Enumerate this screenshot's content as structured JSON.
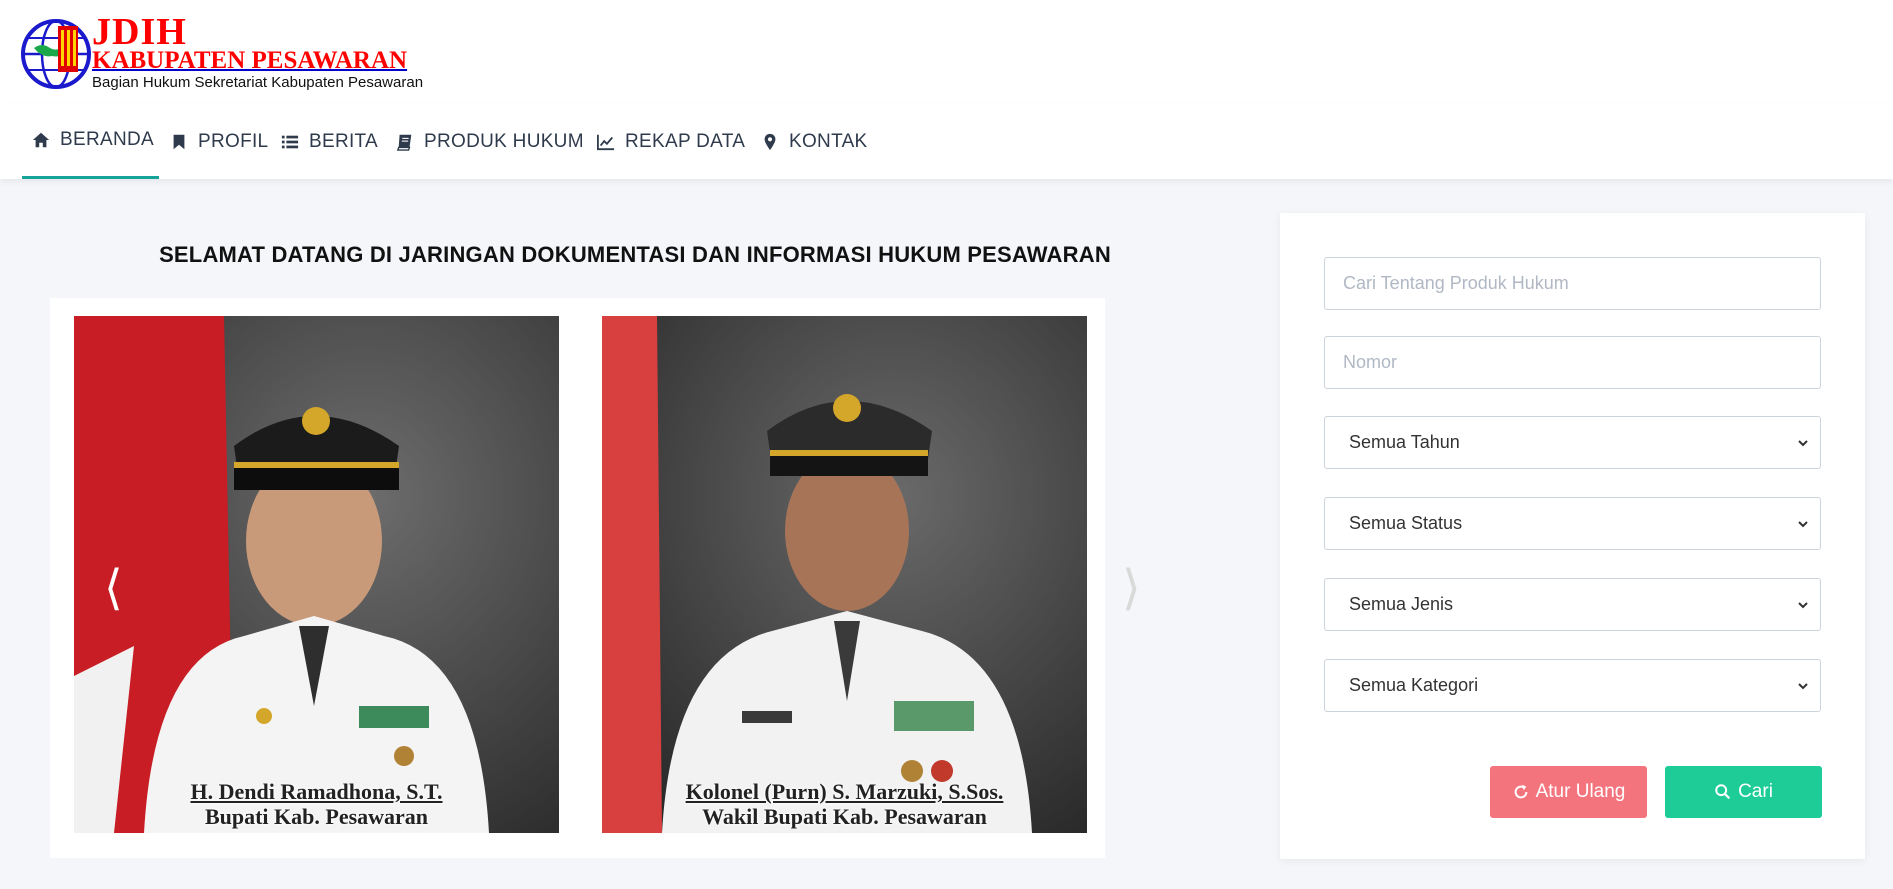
{
  "logo": {
    "title": "JDIH",
    "subtitle": "KABUPATEN PESAWARAN",
    "tagline": "Bagian Hukum Sekretariat Kabupaten Pesawaran"
  },
  "nav": {
    "items": [
      {
        "label": "BERANDA",
        "icon": "home-icon"
      },
      {
        "label": "PROFIL",
        "icon": "bookmark-icon"
      },
      {
        "label": "BERITA",
        "icon": "list-icon"
      },
      {
        "label": "PRODUK HUKUM",
        "icon": "book-icon"
      },
      {
        "label": "REKAP DATA",
        "icon": "line-chart-icon"
      },
      {
        "label": "KONTAK",
        "icon": "map-marker-icon"
      }
    ],
    "active": "BERANDA"
  },
  "main": {
    "welcome": "SELAMAT DATANG DI JARINGAN DOKUMENTASI DAN INFORMASI HUKUM PESAWARAN",
    "slides": [
      {
        "name": "H. Dendi Ramadhona, S.T.",
        "role": "Bupati Kab. Pesawaran"
      },
      {
        "name": "Kolonel (Purn) S. Marzuki, S.Sos.",
        "role": "Wakil Bupati Kab. Pesawaran"
      }
    ],
    "prev_arrow": "⟨",
    "next_arrow": "⟩"
  },
  "search": {
    "query_placeholder": "Cari Tentang Produk Hukum",
    "number_placeholder": "Nomor",
    "year": "Semua Tahun",
    "status": "Semua Status",
    "type": "Semua Jenis",
    "category": "Semua Kategori",
    "reset_label": "Atur Ulang",
    "search_label": "Cari"
  },
  "colors": {
    "accent": "#15a39a",
    "reset": "#f4747e",
    "search": "#1dcc96",
    "logo_red": "#ff0000"
  }
}
